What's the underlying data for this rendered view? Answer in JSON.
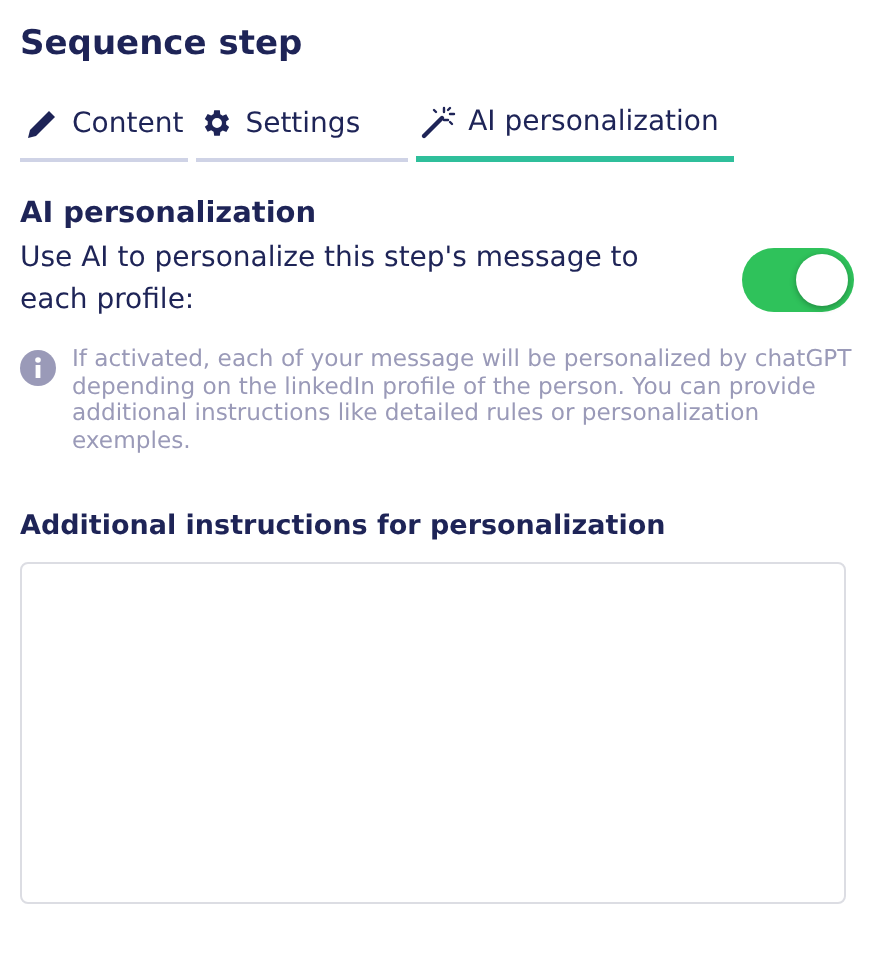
{
  "title": "Sequence step",
  "tabs": [
    {
      "label": "Content",
      "selected": false
    },
    {
      "label": "Settings",
      "selected": false
    },
    {
      "label": "AI personalization",
      "selected": true
    }
  ],
  "section": {
    "heading": "AI personalization",
    "toggle_label": "Use AI to personalize this step's message to each profile:",
    "toggle_on": true,
    "info": "If activated, each of your message will be personalized by chatGPT depending on the linkedIn profile of the person. You can provide additional instructions like detailed rules or personalization exemples."
  },
  "instructions": {
    "label": "Additional instructions for personalization"
  }
}
